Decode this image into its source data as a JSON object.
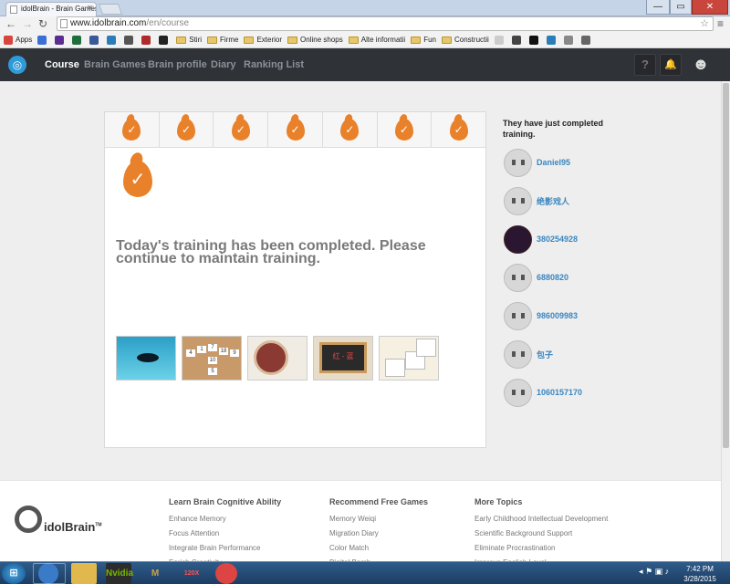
{
  "browser": {
    "tab_title": "idolBrain - Brain Games &",
    "url_host": "www.idolbrain.com",
    "url_path": "/en/course",
    "window_controls": {
      "min": "—",
      "max": "▭",
      "close": "✕"
    }
  },
  "bookmarks": [
    {
      "label": "Apps",
      "type": "apps",
      "color": "#d9453d"
    },
    {
      "label": "",
      "type": "icon",
      "color": "#3b6fd4"
    },
    {
      "label": "",
      "type": "icon",
      "color": "#5c2d91"
    },
    {
      "label": "",
      "type": "icon",
      "color": "#1f6f3d"
    },
    {
      "label": "",
      "type": "icon",
      "color": "#3b5998"
    },
    {
      "label": "",
      "type": "icon",
      "color": "#2a7db8"
    },
    {
      "label": "",
      "type": "icon",
      "color": "#555555"
    },
    {
      "label": "",
      "type": "icon",
      "color": "#b02a2a"
    },
    {
      "label": "",
      "type": "icon",
      "color": "#222222"
    },
    {
      "label": "Stiri",
      "type": "folder"
    },
    {
      "label": "Firme",
      "type": "folder"
    },
    {
      "label": "Exterior",
      "type": "folder"
    },
    {
      "label": "Online shops",
      "type": "folder"
    },
    {
      "label": "Alte informatii",
      "type": "folder"
    },
    {
      "label": "Fun",
      "type": "folder"
    },
    {
      "label": "Constructii",
      "type": "folder"
    },
    {
      "label": "",
      "type": "icon",
      "color": "#cccccc"
    },
    {
      "label": "",
      "type": "icon",
      "color": "#444444"
    },
    {
      "label": "",
      "type": "icon",
      "color": "#111111"
    },
    {
      "label": "",
      "type": "icon",
      "color": "#2a7db8"
    },
    {
      "label": "",
      "type": "icon",
      "color": "#888888"
    },
    {
      "label": "",
      "type": "icon",
      "color": "#666666"
    }
  ],
  "site": {
    "logo": "◎",
    "nav": [
      {
        "label": "Course",
        "active": true
      },
      {
        "label": "Brain Games",
        "active": false
      },
      {
        "label": "Brain profile",
        "active": false
      },
      {
        "label": "Diary",
        "active": false
      },
      {
        "label": "Ranking List",
        "active": false
      }
    ],
    "help_icon": "?",
    "bell_icon": "🔔",
    "avatar_icon": "☻"
  },
  "training": {
    "days_completed": 7,
    "check": "✓",
    "message": "Today's training has been completed. Please continue to maintain training.",
    "games": [
      "fish-game",
      "number-tiles-game",
      "disk-game",
      "chalkboard-game",
      "photo-memory-game"
    ]
  },
  "sidebar": {
    "title": "They have just completed training.",
    "users": [
      {
        "name": "Daniel95",
        "photo": false
      },
      {
        "name": "绝影戏人",
        "photo": false
      },
      {
        "name": "380254928",
        "photo": true
      },
      {
        "name": "6880820",
        "photo": false
      },
      {
        "name": "986009983",
        "photo": false
      },
      {
        "name": "包子",
        "photo": false
      },
      {
        "name": "1060157170",
        "photo": false
      }
    ]
  },
  "footer": {
    "brand": "idolBrain",
    "trademark": "TM",
    "columns": [
      {
        "title": "Learn Brain Cognitive Ability",
        "items": [
          "Enhance Memory",
          "Focus Attention",
          "Integrate Brain Performance",
          "Enrich Creativity"
        ]
      },
      {
        "title": "Recommend Free Games",
        "items": [
          "Memory Weiqi",
          "Migration Diary",
          "Color Match",
          "Digital Bomb"
        ]
      },
      {
        "title": "More Topics",
        "items": [
          "Early Childhood Intellectual Development",
          "Scientific Background Support",
          "Eliminate Procrastination",
          "Improve English Level"
        ]
      }
    ]
  },
  "taskbar": {
    "start": "⊞",
    "apps": [
      "IE",
      "Chrome",
      "Explorer",
      "Nvidia",
      "M",
      "120X",
      "VLC"
    ],
    "clock_time": "7:42 PM",
    "clock_date": "3/28/2015"
  }
}
